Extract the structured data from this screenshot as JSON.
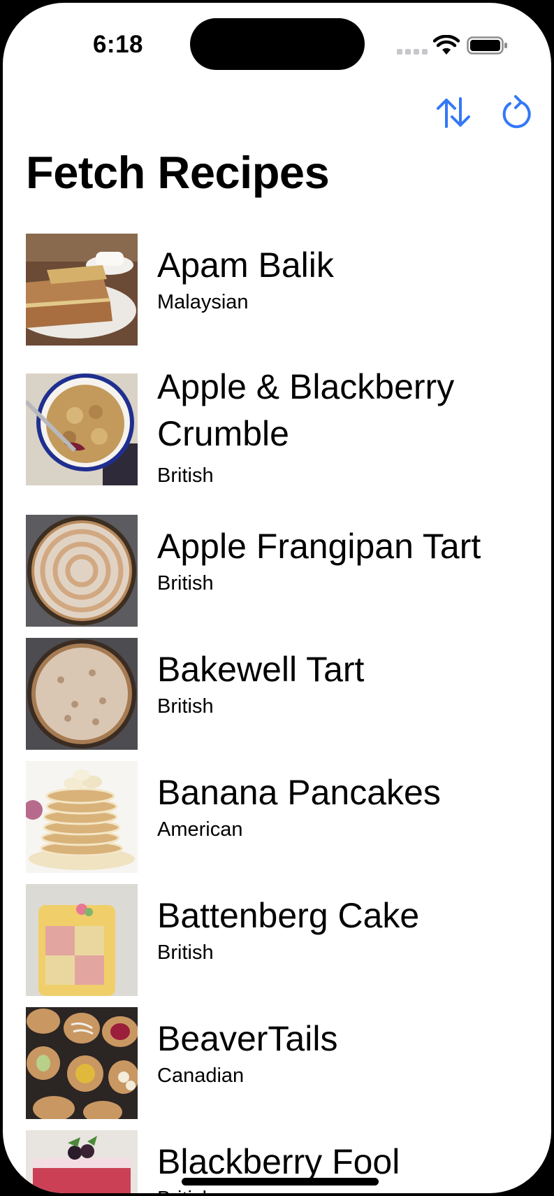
{
  "status_bar": {
    "time": "6:18"
  },
  "toolbar": {
    "sort_icon": "arrow-up-down-icon",
    "refresh_icon": "arrow-clockwise-icon",
    "accent_color": "#3478f6"
  },
  "page": {
    "title": "Fetch Recipes"
  },
  "recipes": [
    {
      "name": "Apam Balik",
      "cuisine": "Malaysian"
    },
    {
      "name": "Apple & Blackberry Crumble",
      "cuisine": "British"
    },
    {
      "name": "Apple Frangipan Tart",
      "cuisine": "British"
    },
    {
      "name": "Bakewell Tart",
      "cuisine": "British"
    },
    {
      "name": "Banana Pancakes",
      "cuisine": "American"
    },
    {
      "name": "Battenberg Cake",
      "cuisine": "British"
    },
    {
      "name": "BeaverTails",
      "cuisine": "Canadian"
    },
    {
      "name": "Blackberry Fool",
      "cuisine": "British"
    }
  ]
}
